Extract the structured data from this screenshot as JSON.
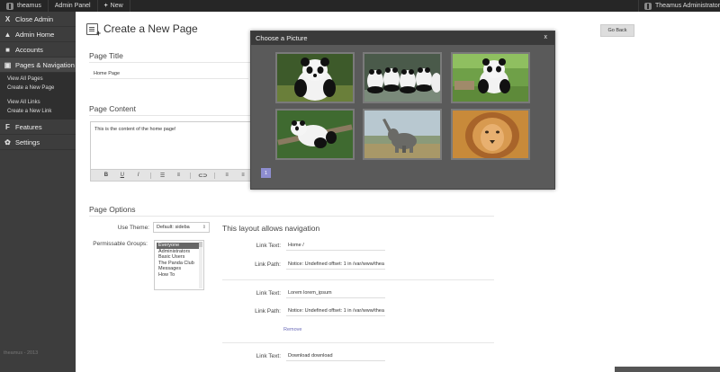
{
  "topbar": {
    "brand": "theamus",
    "admin_panel": "Admin Panel",
    "new_label": "New",
    "user_label": "Theamus Administrator"
  },
  "sidebar": {
    "items": [
      {
        "icon": "close-icon",
        "glyph": "X",
        "label": "Close Admin"
      },
      {
        "icon": "home-icon",
        "glyph": "▲",
        "label": "Admin Home"
      },
      {
        "icon": "accounts-icon",
        "glyph": "■",
        "label": "Accounts"
      },
      {
        "icon": "pages-icon",
        "glyph": "▣",
        "label": "Pages & Navigation"
      },
      {
        "icon": "features-icon",
        "glyph": "F",
        "label": "Features"
      },
      {
        "icon": "settings-icon",
        "glyph": "✿",
        "label": "Settings"
      }
    ],
    "sub_items": [
      "View All Pages",
      "Create a New Page",
      "View All Links",
      "Create a New Link"
    ],
    "footer": "theamus - 2013"
  },
  "main": {
    "title": "Create a New Page",
    "go_back": "Go Back",
    "page_title_label": "Page Title",
    "page_title_value": "Home Page",
    "page_content_label": "Page Content",
    "page_content_value": "This is the content of the home page!",
    "toolbar": {
      "bold": "B",
      "underline": "U",
      "italic": "I",
      "ul": "☰",
      "ol": "≡",
      "link": "⊂⊃",
      "align_left": "≡",
      "align_center": "≡"
    },
    "page_options_label": "Page Options",
    "use_theme_label": "Use Theme:",
    "theme_value": "Default: sideba",
    "groups_label": "Permissable Groups:",
    "groups": [
      "Everyone",
      "Administrators",
      "Basic Users",
      "The Panda Club",
      "Messages",
      "How To"
    ],
    "layout_title": "This layout allows navigation",
    "link_text_label": "Link Text:",
    "link_path_label": "Link Path:",
    "links": [
      {
        "text": "Home /",
        "path": "Notice: Undefined offset: 1 in /var/www/thea"
      },
      {
        "text": "Lorem lorem_ipsum",
        "path": "Notice: Undefined offset: 1 in /var/www/thea"
      },
      {
        "text": "Download download"
      }
    ],
    "remove_label": "Remove"
  },
  "modal": {
    "title": "Choose a Picture",
    "close": "x",
    "images": [
      "panda-sitting",
      "pandas-group",
      "panda-grass",
      "panda-tree",
      "elephant",
      "lion"
    ],
    "page": "1"
  }
}
